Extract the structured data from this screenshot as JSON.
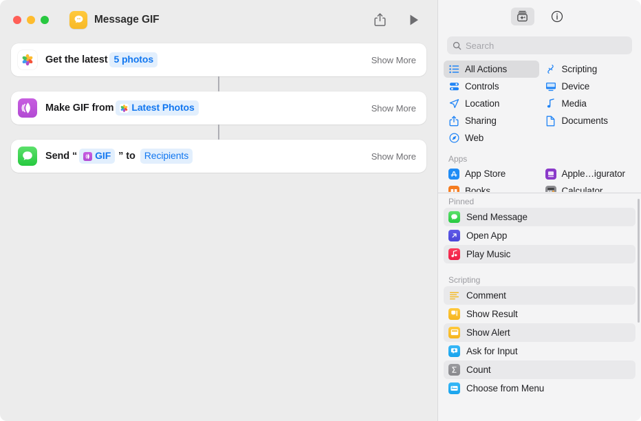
{
  "window": {
    "title": "Message GIF",
    "doc_icon": "messages-app-icon",
    "traffic_lights": [
      "close",
      "minimize",
      "zoom"
    ]
  },
  "toolbar": {
    "share_label": "share-icon",
    "run_label": "run-icon"
  },
  "workflow": {
    "actions": [
      {
        "icon": "photos-app-icon",
        "prefix": "Get the latest",
        "token": "5 photos",
        "token_icon": null,
        "suffix": "",
        "suffix2": "",
        "token2": null,
        "show_more": "Show More"
      },
      {
        "icon": "gif-maker-icon",
        "prefix": "Make GIF from",
        "token": "Latest Photos",
        "token_icon": "photos-variable-icon",
        "suffix": "",
        "suffix2": "",
        "token2": null,
        "show_more": "Show More"
      },
      {
        "icon": "messages-app-icon",
        "prefix": "Send “",
        "token": "GIF",
        "token_icon": "gif-variable-icon",
        "suffix": "” to",
        "token2": "Recipients",
        "suffix2": "",
        "show_more": "Show More"
      }
    ]
  },
  "sidebar": {
    "toolbar": {
      "action_library_label": "action-library-icon",
      "info_label": "info-circle-icon"
    },
    "search": {
      "placeholder": "Search",
      "value": ""
    },
    "categories": [
      {
        "label": "All Actions",
        "icon": "list-bullet-icon",
        "selected": true
      },
      {
        "label": "Scripting",
        "icon": "scripting-icon",
        "selected": false
      },
      {
        "label": "Controls",
        "icon": "controls-icon",
        "selected": false
      },
      {
        "label": "Device",
        "icon": "device-icon",
        "selected": false
      },
      {
        "label": "Location",
        "icon": "location-icon",
        "selected": false
      },
      {
        "label": "Media",
        "icon": "media-note-icon",
        "selected": false
      },
      {
        "label": "Sharing",
        "icon": "sharing-icon",
        "selected": false
      },
      {
        "label": "Documents",
        "icon": "documents-icon",
        "selected": false
      },
      {
        "label": "Web",
        "icon": "web-compass-icon",
        "selected": false
      }
    ],
    "apps_section": {
      "title": "Apps",
      "items": [
        {
          "label": "App Store",
          "icon": "app-store-icon"
        },
        {
          "label": "Apple…igurator",
          "icon": "apple-configurator-icon"
        },
        {
          "label": "Books",
          "icon": "books-icon"
        },
        {
          "label": "Calculator",
          "icon": "calculator-icon"
        }
      ]
    },
    "pinned_section": {
      "title": "Pinned",
      "items": [
        {
          "label": "Send Message",
          "icon": "messages-app-icon",
          "alt": true
        },
        {
          "label": "Open App",
          "icon": "open-app-icon",
          "alt": false
        },
        {
          "label": "Play Music",
          "icon": "music-app-icon",
          "alt": true
        }
      ]
    },
    "scripting_section": {
      "title": "Scripting",
      "items": [
        {
          "label": "Comment",
          "icon": "comment-icon",
          "alt": true
        },
        {
          "label": "Show Result",
          "icon": "show-result-icon",
          "alt": false
        },
        {
          "label": "Show Alert",
          "icon": "show-alert-icon",
          "alt": true
        },
        {
          "label": "Ask for Input",
          "icon": "ask-for-input-icon",
          "alt": false
        },
        {
          "label": "Count",
          "icon": "count-sigma-icon",
          "alt": true
        },
        {
          "label": "Choose from Menu",
          "icon": "choose-from-menu-icon",
          "alt": false
        }
      ]
    }
  },
  "colors": {
    "accent_blue": "#1277f0",
    "token_bg": "#e2effd",
    "window_bg": "#ececec",
    "sidebar_bg": "#f4f4f5",
    "selected_row": "#dcdcde",
    "close_red": "#ff5f57",
    "minimize_yellow": "#febc2e",
    "zoom_green": "#28c840"
  }
}
